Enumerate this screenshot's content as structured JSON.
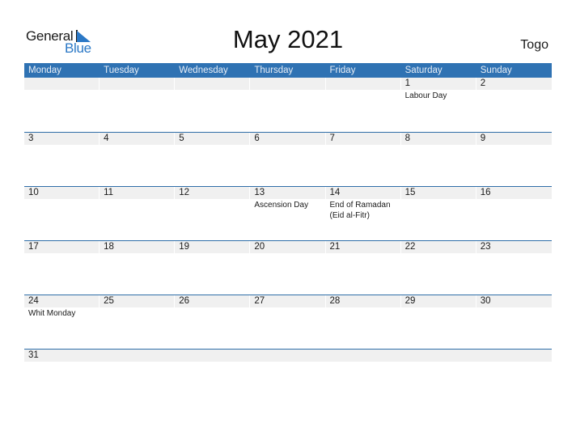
{
  "brand": {
    "word1": "General",
    "word2": "Blue",
    "color": "#2b78c6"
  },
  "title": "May 2021",
  "country": "Togo",
  "colors": {
    "header_bg": "#2f72b3",
    "date_row_bg": "#f0f0f0",
    "rule": "#2f6ea8"
  },
  "weekdays": [
    "Monday",
    "Tuesday",
    "Wednesday",
    "Thursday",
    "Friday",
    "Saturday",
    "Sunday"
  ],
  "weeks": [
    {
      "days": [
        {
          "num": "",
          "holiday": ""
        },
        {
          "num": "",
          "holiday": ""
        },
        {
          "num": "",
          "holiday": ""
        },
        {
          "num": "",
          "holiday": ""
        },
        {
          "num": "",
          "holiday": ""
        },
        {
          "num": "1",
          "holiday": "Labour Day"
        },
        {
          "num": "2",
          "holiday": ""
        }
      ]
    },
    {
      "days": [
        {
          "num": "3",
          "holiday": ""
        },
        {
          "num": "4",
          "holiday": ""
        },
        {
          "num": "5",
          "holiday": ""
        },
        {
          "num": "6",
          "holiday": ""
        },
        {
          "num": "7",
          "holiday": ""
        },
        {
          "num": "8",
          "holiday": ""
        },
        {
          "num": "9",
          "holiday": ""
        }
      ]
    },
    {
      "days": [
        {
          "num": "10",
          "holiday": ""
        },
        {
          "num": "11",
          "holiday": ""
        },
        {
          "num": "12",
          "holiday": ""
        },
        {
          "num": "13",
          "holiday": "Ascension Day"
        },
        {
          "num": "14",
          "holiday": "End of Ramadan (Eid al-Fitr)"
        },
        {
          "num": "15",
          "holiday": ""
        },
        {
          "num": "16",
          "holiday": ""
        }
      ]
    },
    {
      "days": [
        {
          "num": "17",
          "holiday": ""
        },
        {
          "num": "18",
          "holiday": ""
        },
        {
          "num": "19",
          "holiday": ""
        },
        {
          "num": "20",
          "holiday": ""
        },
        {
          "num": "21",
          "holiday": ""
        },
        {
          "num": "22",
          "holiday": ""
        },
        {
          "num": "23",
          "holiday": ""
        }
      ]
    },
    {
      "days": [
        {
          "num": "24",
          "holiday": "Whit Monday"
        },
        {
          "num": "25",
          "holiday": ""
        },
        {
          "num": "26",
          "holiday": ""
        },
        {
          "num": "27",
          "holiday": ""
        },
        {
          "num": "28",
          "holiday": ""
        },
        {
          "num": "29",
          "holiday": ""
        },
        {
          "num": "30",
          "holiday": ""
        }
      ]
    },
    {
      "days": [
        {
          "num": "31",
          "holiday": ""
        }
      ]
    }
  ]
}
